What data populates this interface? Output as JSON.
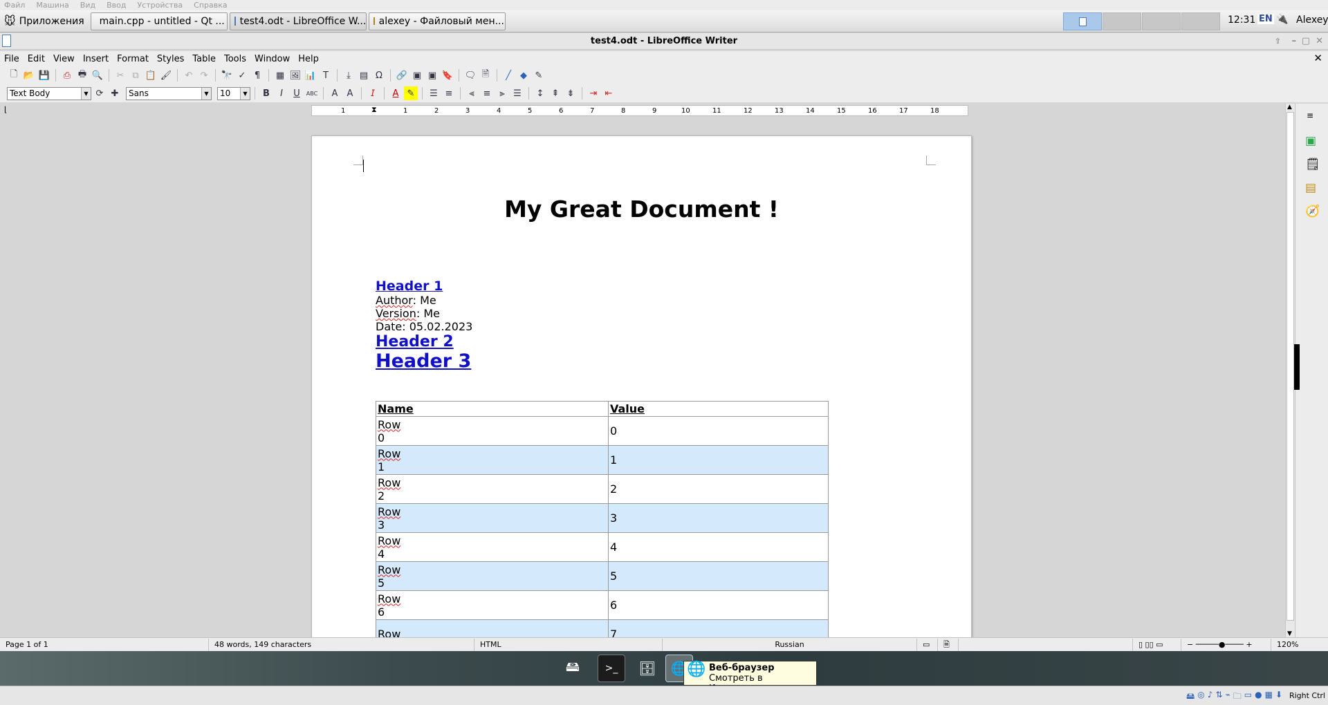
{
  "vm_menu": [
    "Файл",
    "Машина",
    "Вид",
    "Ввод",
    "Устройства",
    "Справка"
  ],
  "panel": {
    "apps_label": "Приложения",
    "tasks": [
      {
        "label": "main.cpp - untitled - Qt ...",
        "icon": "qt-creator-icon"
      },
      {
        "label": "test4.odt - LibreOffice W...",
        "icon": "writer-icon"
      },
      {
        "label": "alexey - Файловый мен...",
        "icon": "folder-icon"
      }
    ],
    "clock": "12:31",
    "lang": "EN",
    "user": "Alexey"
  },
  "window": {
    "title": "test4.odt - LibreOffice Writer"
  },
  "menu": [
    "File",
    "Edit",
    "View",
    "Insert",
    "Format",
    "Styles",
    "Table",
    "Tools",
    "Window",
    "Help"
  ],
  "format_bar": {
    "style": "Text Body",
    "font": "Sans",
    "size": "10"
  },
  "ruler": {
    "marks": [
      "1",
      "1",
      "2",
      "3",
      "4",
      "5",
      "6",
      "7",
      "8",
      "9",
      "10",
      "11",
      "12",
      "13",
      "14",
      "15",
      "16",
      "17",
      "18"
    ]
  },
  "document": {
    "title": "My Great Document !",
    "header1": "Header 1",
    "author_label": "Author",
    "author_value": ": Me",
    "version_label": "Version",
    "version_value": ": Me",
    "date_label": "Date",
    "date_value": ": 05.02.2023",
    "header2": "Header 2",
    "header3": "Header 3",
    "table": {
      "headers": [
        "Name",
        "Value"
      ],
      "rows": [
        {
          "name_a": "Row",
          "name_b": "0",
          "value": "0"
        },
        {
          "name_a": "Row",
          "name_b": "1",
          "value": "1"
        },
        {
          "name_a": "Row",
          "name_b": "2",
          "value": "2"
        },
        {
          "name_a": "Row",
          "name_b": "3",
          "value": "3"
        },
        {
          "name_a": "Row",
          "name_b": "4",
          "value": "4"
        },
        {
          "name_a": "Row",
          "name_b": "5",
          "value": "5"
        },
        {
          "name_a": "Row",
          "name_b": "6",
          "value": "6"
        },
        {
          "name_a": "Row",
          "name_b": "",
          "value": "7"
        }
      ]
    }
  },
  "status": {
    "page": "Page 1 of 1",
    "words": "48 words, 149 characters",
    "mode": "HTML",
    "language": "Russian",
    "zoom": "120%"
  },
  "tooltip": {
    "title": "Веб-браузер",
    "subtitle": "Смотреть в Интернете"
  },
  "vm_status": {
    "right_ctrl": "Right Ctrl"
  },
  "colors": {
    "link": "#1010c8",
    "alt_row": "#d4eafc",
    "workspace_active": "#a9c8ea"
  }
}
